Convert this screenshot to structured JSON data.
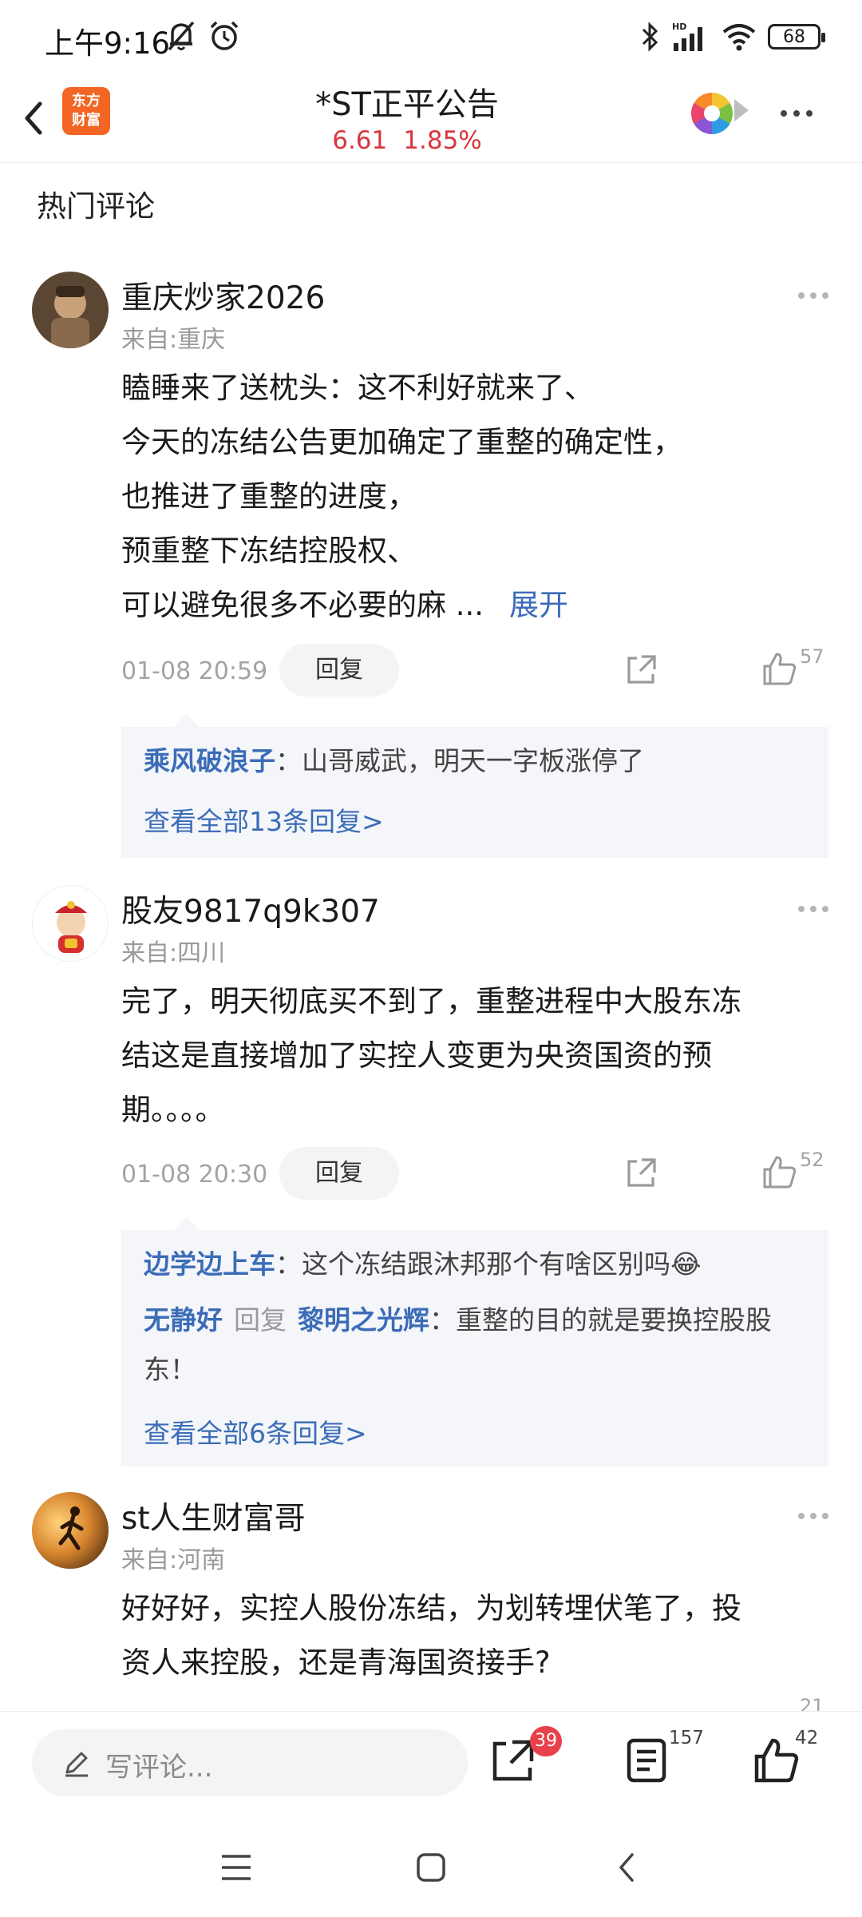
{
  "status_bar": {
    "time": "上午9:16",
    "battery": "68"
  },
  "header": {
    "logo_text_line1": "东方",
    "logo_text_line2": "财富",
    "title": "*ST正平公告",
    "price": "6.61",
    "change": "1.85%",
    "accent_color": "#d9363e"
  },
  "section_title": "热门评论",
  "comments": [
    {
      "user": "重庆炒家2026",
      "location": "来自:重庆",
      "lines": [
        "瞌睡来了送枕头：这不利好就来了、",
        "今天的冻结公告更加确定了重整的确定性，",
        "也推进了重整的进度，",
        "预重整下冻结控股权、",
        "可以避免很多不必要的麻 ..."
      ],
      "expand_label": "展开",
      "time": "01-08 20:59",
      "reply_label": "回复",
      "likes": "57",
      "replies": [
        {
          "name": "乘风破浪子",
          "text": "：山哥威武，明天一字板涨停了"
        }
      ],
      "view_all": "查看全部13条回复>"
    },
    {
      "user": "股友9817q9k307",
      "location": "来自:四川",
      "lines": [
        "完了，明天彻底买不到了，重整进程中大股东冻",
        "结这是直接增加了实控人变更为央资国资的预",
        "期。。。。"
      ],
      "time": "01-08 20:30",
      "reply_label": "回复",
      "likes": "52",
      "replies": [
        {
          "name": "边学边上车",
          "text": "：这个冻结跟沐邦那个有啥区别吗😂"
        },
        {
          "name": "无静好",
          "middle": "回复",
          "target": "黎明之光辉",
          "text": "：重整的目的就是要换控股股东！"
        }
      ],
      "view_all": "查看全部6条回复>"
    },
    {
      "user": "st人生财富哥",
      "location": "来自:河南",
      "lines": [
        "好好好，实控人股份冻结，为划转埋伏笔了，投",
        "资人来控股，还是青海国资接手?"
      ],
      "likes": "21"
    }
  ],
  "toolbar": {
    "write_placeholder": "写评论...",
    "share_badge": "39",
    "comment_count": "157",
    "like_count": "42"
  }
}
